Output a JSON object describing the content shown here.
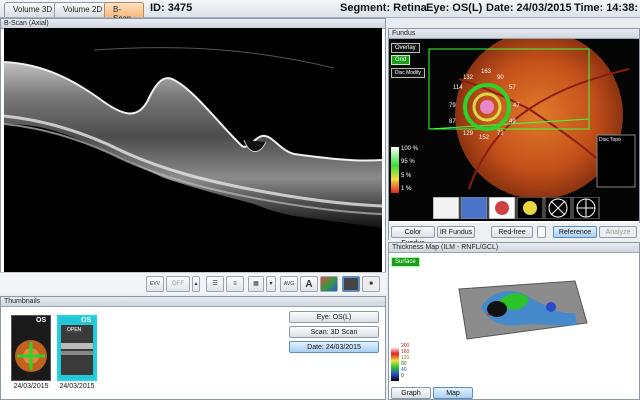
{
  "tabs": [
    {
      "label": "Volume 3D"
    },
    {
      "label": "Volume 2D"
    },
    {
      "label": "B-Scan"
    }
  ],
  "header": {
    "id": "ID: 3475",
    "scan": "Segment: Retina",
    "eye": "Eye: OS(L)",
    "date": "Date: 24/03/2015",
    "time": "Time: 14:38:"
  },
  "bscan_panel": {
    "title": "B-Scan (Axial)"
  },
  "toolbar": {
    "evv": "EVV",
    "off": "OFF",
    "avg": "AVG",
    "font_a": "A"
  },
  "thumbnails": {
    "title": "Thumbnails",
    "items": [
      {
        "eye": "OS",
        "date": "24/03/2015"
      },
      {
        "eye": "OS",
        "tag": "OPEN",
        "date": "24/03/2015"
      }
    ],
    "eye_button": "Eye: OS(L)",
    "scan_button": "Scan: 3D Scan",
    "date_button": "Date: 24/03/2015"
  },
  "fundus": {
    "title": "Fundus",
    "overlay_label": "Overlay",
    "grid_label": "Grid",
    "disc_modify": "Disc Modify",
    "legend": [
      "100 %",
      "95 %",
      "5 %",
      "1 %"
    ],
    "sectors": [
      {
        "value": "163",
        "color": "#ffffff"
      },
      {
        "value": "132",
        "color": "#ffffff"
      },
      {
        "value": "90",
        "color": "#ffffff"
      },
      {
        "value": "114",
        "color": "#ffffff"
      },
      {
        "value": "57",
        "color": "#ffffff"
      },
      {
        "value": "79",
        "color": "#ffffff"
      },
      {
        "value": "47",
        "color": "#ffffff"
      },
      {
        "value": "87",
        "color": "#ffffff"
      },
      {
        "value": "49",
        "color": "#ffffff"
      },
      {
        "value": "129",
        "color": "#ffffff"
      },
      {
        "value": "72",
        "color": "#ffffff"
      },
      {
        "value": "152",
        "color": "#ffffff"
      }
    ],
    "disc_topo_title": "Disc Topo",
    "buttons": {
      "color_fundus": "Color Fundus",
      "ir_fundus": "IR Fundus",
      "red_free": "Red-free",
      "reference": "Reference",
      "analyze": "Analyze"
    }
  },
  "thickness": {
    "title": "Thickness Map  (ILM - RNFL/GCL)",
    "surface_label": "Surface",
    "legend": [
      "200",
      "160",
      "120",
      "80",
      "40",
      "0"
    ],
    "graph_tab": "Graph",
    "map_tab": "Map"
  },
  "colors": {
    "accent_tab": "#f7b77a",
    "selected_button": "#a9cff4",
    "grid_green": "#3cff3c"
  }
}
